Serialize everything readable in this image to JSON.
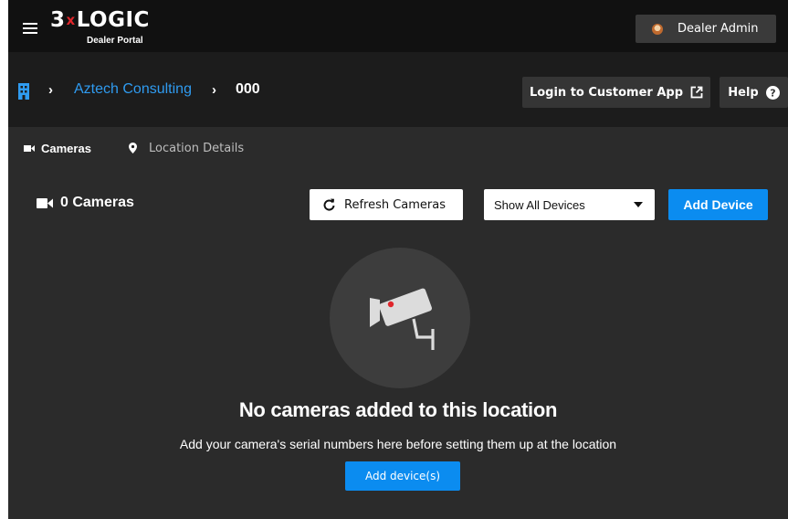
{
  "header": {
    "logo_main_left": "3",
    "logo_x": "x",
    "logo_main_right": "LOGIC",
    "logo_sub": "Dealer Portal",
    "user_name": "Dealer Admin"
  },
  "breadcrumb": {
    "separator": "›",
    "customer": "Aztech Consulting",
    "location": "000"
  },
  "actions": {
    "login_customer_app": "Login to Customer App",
    "help": "Help"
  },
  "tabs": [
    {
      "label": "Cameras",
      "active": true
    },
    {
      "label": "Location Details",
      "active": false
    }
  ],
  "toolbar": {
    "camera_count": "0 Cameras",
    "refresh_label": "Refresh Cameras",
    "filter_value": "Show All Devices",
    "add_device_label": "Add Device"
  },
  "empty_state": {
    "title": "No cameras added to this location",
    "subtitle": "Add your camera's serial numbers here before setting them up at the location",
    "button_label": "Add device(s)"
  },
  "colors": {
    "accent_blue": "#0b8cf0",
    "link_blue": "#2f9bf0",
    "logo_red": "#e0262b"
  },
  "icons": [
    "hamburger-icon",
    "avatar",
    "building-icon",
    "external-link-icon",
    "help-circle-icon",
    "video-camera-icon",
    "map-pin-icon",
    "refresh-icon",
    "caret-down-icon",
    "security-camera-icon"
  ]
}
